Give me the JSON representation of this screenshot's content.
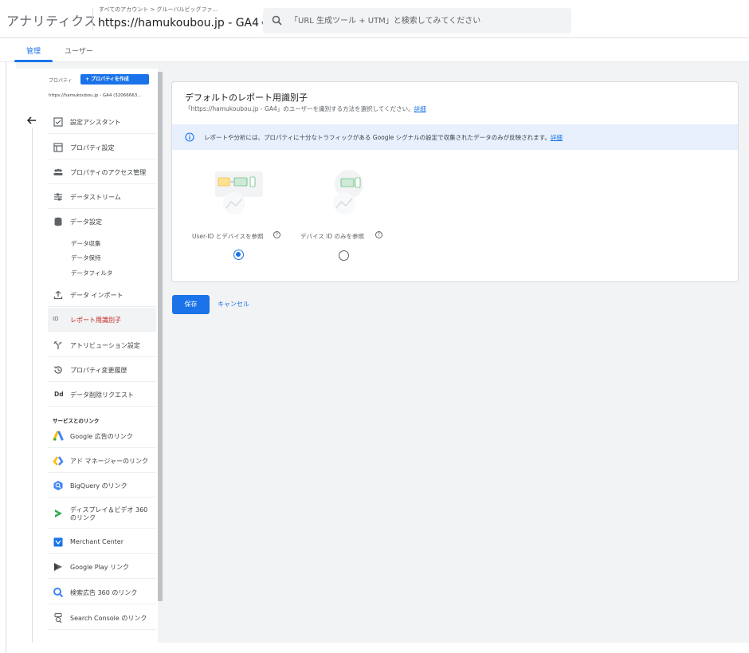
{
  "header": {
    "app_title": "アナリティクス",
    "breadcrumb": "すべてのアカウント > グルーバルビッグファ...",
    "property_name": "https://hamukoubou.jp - GA4",
    "search_placeholder": "「URL 生成ツール + UTM」と検索してみてください"
  },
  "tabs": [
    {
      "label": "管理"
    },
    {
      "label": "ユーザー"
    }
  ],
  "sidebar": {
    "property_label": "プロパティ",
    "create_button": "+ プロパティを作成",
    "property_url": "https://hamukoubou.jp - GA4 (32066663...",
    "items": [
      {
        "label": "設定アシスタント",
        "icon": "checkbox-icon"
      },
      {
        "label": "プロパティ設定",
        "icon": "property-settings-icon"
      },
      {
        "label": "プロパティのアクセス管理",
        "icon": "people-icon"
      },
      {
        "label": "データストリーム",
        "icon": "data-stream-icon"
      },
      {
        "label": "データ設定",
        "icon": "database-icon"
      },
      {
        "label": "データ インポート",
        "icon": "upload-icon"
      },
      {
        "label": "レポート用識別子",
        "icon": "reporting-identity-icon",
        "tag": "ID"
      },
      {
        "label": "アトリビューション設定",
        "icon": "attribution-icon"
      },
      {
        "label": "プロパティ変更履歴",
        "icon": "history-icon"
      },
      {
        "label": "データ削除リクエスト",
        "icon": "dd-icon",
        "tag": "Dd"
      }
    ],
    "sub_items": [
      "データ収集",
      "データ保持",
      "データフィルタ"
    ],
    "section_title": "サービスとのリンク",
    "links": [
      {
        "label": "Google 広告のリンク",
        "icon": "google-ads-icon"
      },
      {
        "label": "アド マネージャーのリンク",
        "icon": "ad-manager-icon"
      },
      {
        "label": "BigQuery のリンク",
        "icon": "bigquery-icon"
      },
      {
        "label": "ディスプレイ＆ビデオ 360",
        "label2": "のリンク",
        "icon": "dv360-icon"
      },
      {
        "label": "Merchant Center",
        "icon": "merchant-center-icon"
      },
      {
        "label": "Google Play リンク",
        "icon": "google-play-icon"
      },
      {
        "label": "検索広告 360 のリンク",
        "icon": "search-ads-360-icon"
      },
      {
        "label": "Search Console のリンク",
        "icon": "search-console-icon"
      }
    ]
  },
  "card": {
    "title": "デフォルトのレポート用識別子",
    "subtitle": "「https://hamukoubou.jp - GA4」のユーザーを識別する方法を選択してください。",
    "subtitle_link": "詳細",
    "info_text": "レポートや分析には、プロパティに十分なトラフィックがある Google シグナルの設定で収集されたデータのみが反映されます。",
    "info_link": "詳細",
    "options": [
      {
        "label": "User-ID とデバイスを参照",
        "selected": true
      },
      {
        "label": "デバイス ID のみを参照",
        "selected": false
      }
    ]
  },
  "actions": {
    "save": "保存",
    "cancel": "キャンセル"
  },
  "colors": {
    "accent": "#1a73e8",
    "active_nav_text": "#c5221f",
    "info_bg": "#e8f0fe"
  }
}
